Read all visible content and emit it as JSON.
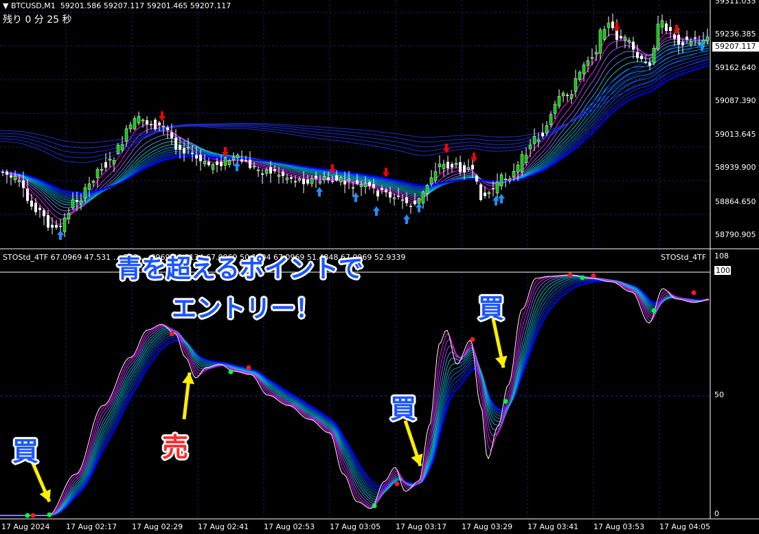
{
  "header": {
    "symbol": "BTCUSD,M1",
    "ohlc": "59201.586 59207.117 59201.465 59207.117",
    "timer": "残り 0 分 25 秒"
  },
  "price_axis": {
    "labels": [
      "59311.035",
      "59236.385",
      "59162.640",
      "59087.390",
      "59013.645",
      "58939.900",
      "58864.650",
      "58790.905"
    ],
    "current_price": "59207.117"
  },
  "indicator": {
    "header": "STOStd_4TF 67.0969 47.531 … STO … 0969 48.8134 67.0969 50.1204 67.0969 51.4848 67.0969 52.9339",
    "header_right": "STOStd_4TF",
    "levels": [
      "108",
      "100",
      "50",
      "0"
    ]
  },
  "time_axis": {
    "labels": [
      "17 Aug 2024",
      "17 Aug 02:17",
      "17 Aug 02:29",
      "17 Aug 02:41",
      "17 Aug 02:53",
      "17 Aug 03:05",
      "17 Aug 03:17",
      "17 Aug 03:29",
      "17 Aug 03:41",
      "17 Aug 03:53",
      "17 Aug 04:05"
    ]
  },
  "annotations": {
    "line1": "青を超えるポイントで",
    "line2": "エントリー！",
    "buy": "買",
    "sell": "売"
  },
  "colors": {
    "background": "#000000",
    "bull_candle": "#00c800",
    "bear_candle": "#ffffff",
    "ribbon_fast": "#ff00ff",
    "ribbon_mid": "#00c8c8",
    "ribbon_slow": "#0000ff",
    "buy_arrow": "#1e90ff",
    "sell_arrow": "#ff0000",
    "annotation_blue": "#1a55ff",
    "annotation_red": "#ff2a2a",
    "pointer_arrow": "#ffee00"
  }
}
